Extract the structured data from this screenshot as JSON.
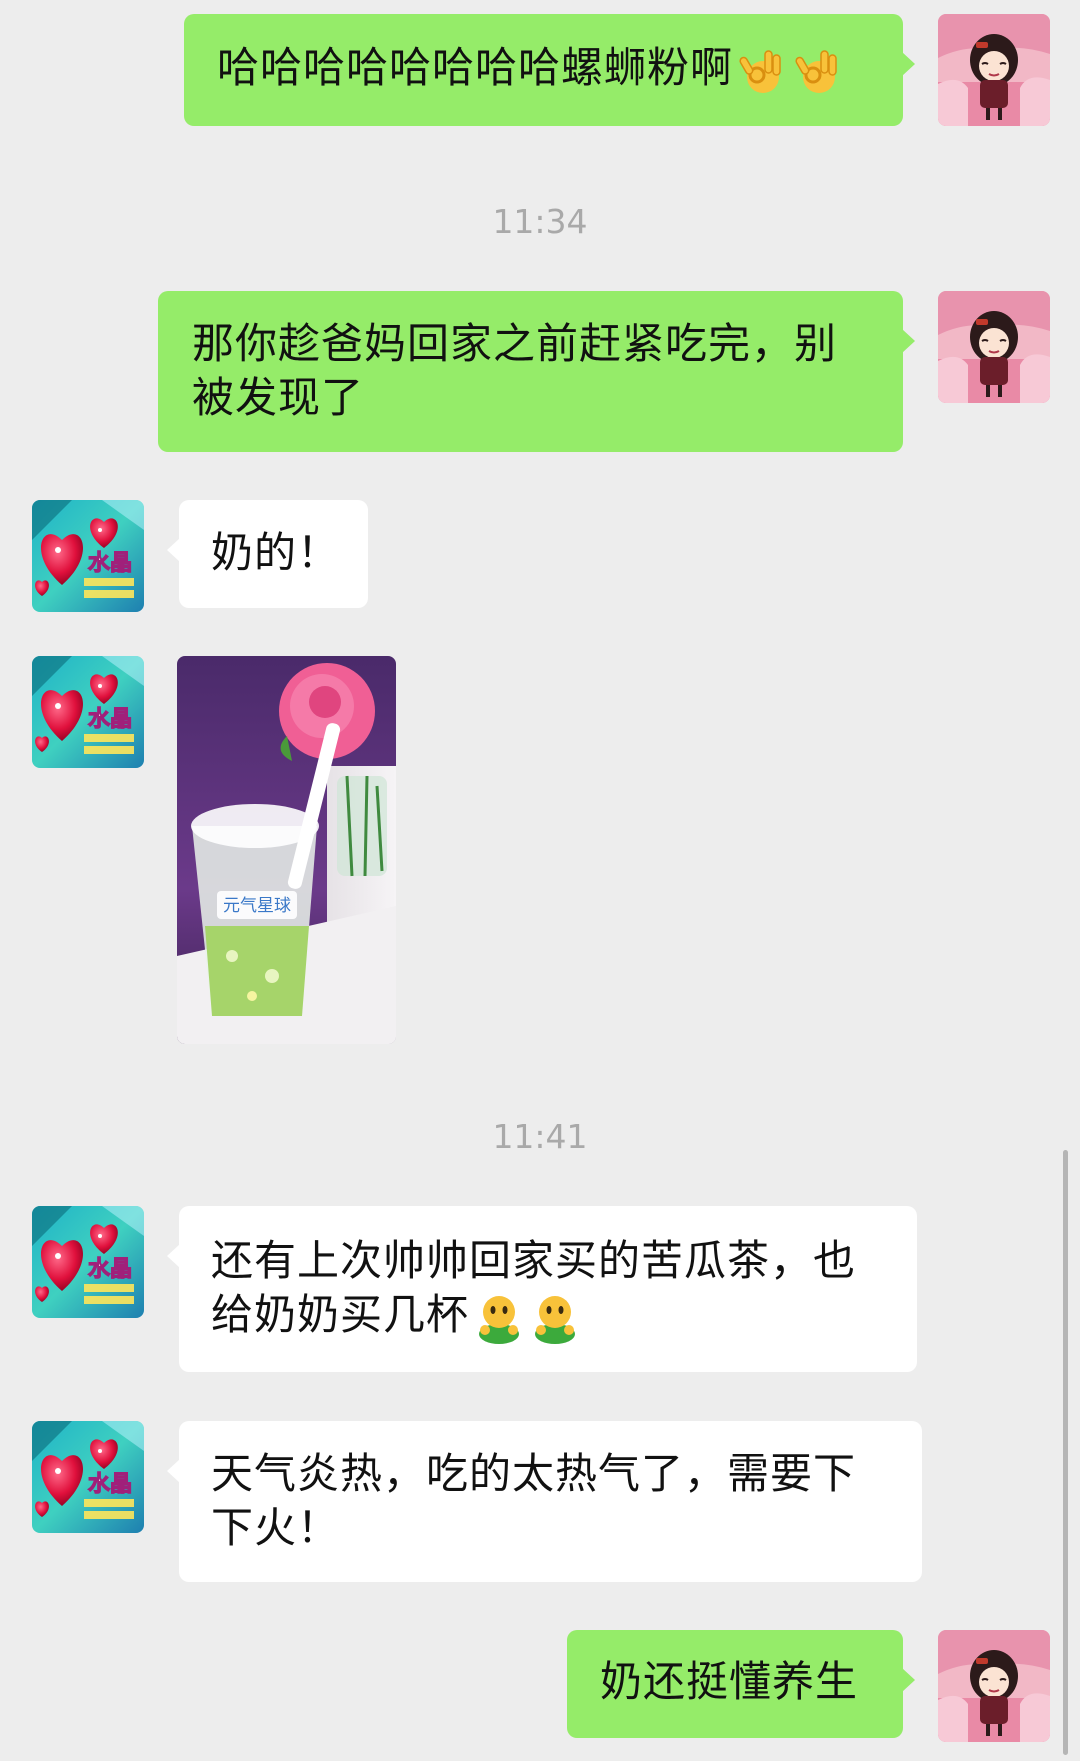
{
  "chat": {
    "messages": [
      {
        "from": "me",
        "text": "哈哈哈哈哈哈哈哈螺蛳粉啊",
        "emoji": [
          "ok-hand-emoji",
          "ok-hand-emoji"
        ]
      },
      {
        "from": "them",
        "text": "那你趁爸妈回家之前赶紧吃完，别被发现了"
      },
      {
        "from": "them",
        "text": "奶的！"
      },
      {
        "from": "them",
        "type": "image",
        "image": "bitter-melon-tea-cup-photo"
      },
      {
        "from": "them",
        "text": "还有上次帅帅回家买的苦瓜茶，也给奶奶买几杯",
        "emoji": [
          "face-hug-emoji",
          "face-hug-emoji"
        ]
      },
      {
        "from": "them",
        "text": "天气炎热，吃的太热气了，需要下下火！"
      },
      {
        "from": "me",
        "text": "奶还挺懂养生"
      }
    ],
    "timestamps": [
      "11:34",
      "11:41"
    ],
    "msg1_text": "哈哈哈哈哈哈哈哈螺蛳粉啊",
    "msg2_line1": "那你趁爸妈回家之前赶紧吃完，别",
    "msg2_line2": "被发现了",
    "msg3_text": "奶的！",
    "msg5_line1": "还有上次帅帅回家买的苦瓜茶，也",
    "msg5_line2": "给奶奶买几杯",
    "msg6_line1": "天气炎热，吃的太热气了，需要下",
    "msg6_line2": "下火！",
    "msg7_text": "奶还挺懂养生",
    "ts1": "11:34",
    "ts2": "11:41",
    "avatar_self": "cartoon-girl-avatar",
    "avatar_other": "crystal-heart-avatar",
    "photo_cup_text": "元气星球"
  },
  "colors": {
    "background": "#ededed",
    "bubble_out": "#95ec69",
    "bubble_in": "#ffffff",
    "timestamp": "#a9a9a9"
  }
}
